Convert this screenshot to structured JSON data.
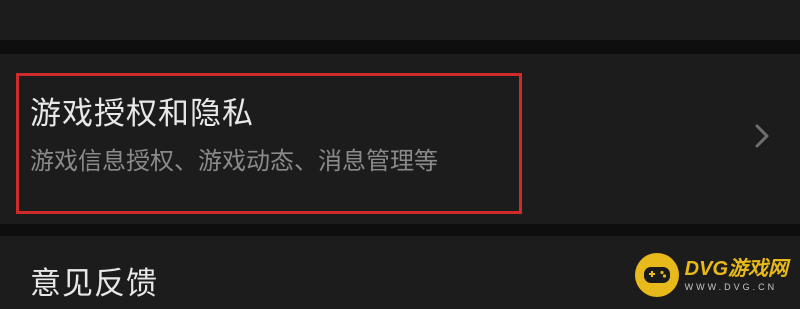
{
  "settings": {
    "game_privacy": {
      "title": "游戏授权和隐私",
      "subtitle": "游戏信息授权、游戏动态、消息管理等",
      "chevron_icon": "chevron-right-icon"
    },
    "feedback": {
      "label": "意见反馈"
    }
  },
  "highlight": {
    "color": "#d02b2b"
  },
  "watermark": {
    "brand": "DVG游戏网",
    "url": "WWW.DVG.CN",
    "logo_icon": "gamepad-logo-icon",
    "color": "#f3c21a"
  },
  "theme": {
    "background": "#0b0b0b",
    "row_background": "#1c1c1c",
    "title_color": "#e8e8e8",
    "subtitle_color": "#8a8a8a"
  }
}
